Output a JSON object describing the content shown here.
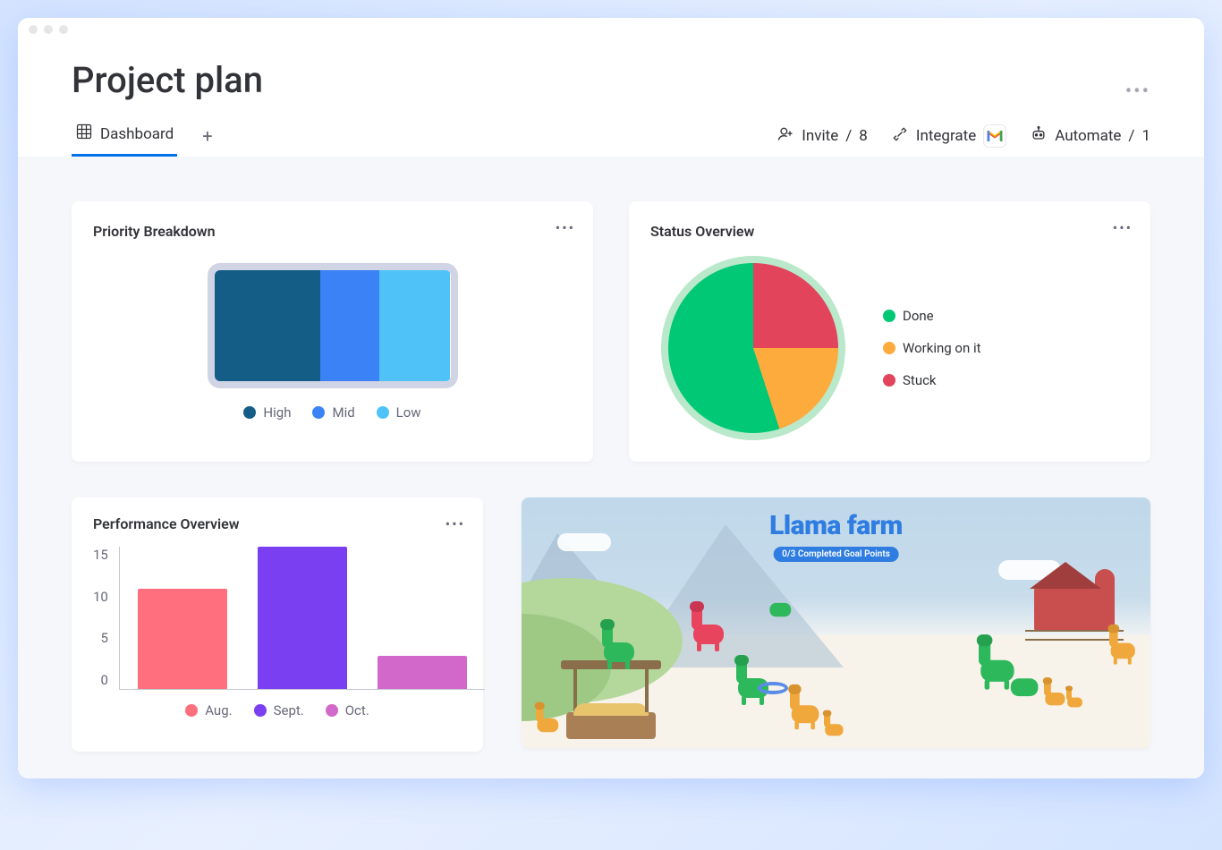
{
  "page": {
    "title": "Project plan"
  },
  "tabs": {
    "dashboard": "Dashboard"
  },
  "actions": {
    "invite_label": "Invite",
    "invite_count": "8",
    "integrate_label": "Integrate",
    "automate_label": "Automate",
    "automate_count": "1"
  },
  "cards": {
    "priority": {
      "title": "Priority Breakdown",
      "legend_high": "High",
      "legend_mid": "Mid",
      "legend_low": "Low"
    },
    "status": {
      "title": "Status Overview",
      "legend_done": "Done",
      "legend_working": "Working on it",
      "legend_stuck": "Stuck"
    },
    "performance": {
      "title": "Performance Overview",
      "y_15": "15",
      "y_10": "10",
      "y_5": "5",
      "y_0": "0",
      "legend_aug": "Aug.",
      "legend_sept": "Sept.",
      "legend_oct": "Oct."
    },
    "farm": {
      "title": "Llama farm",
      "badge": "0/3 Completed Goal Points"
    }
  },
  "colors": {
    "high": "#135d87",
    "mid": "#3b82f6",
    "low": "#4fc3f7",
    "done": "#00c875",
    "working": "#fdab3d",
    "stuck": "#e2445c",
    "aug": "#ff6f7d",
    "sept": "#7b3ff2",
    "oct": "#d268c9"
  },
  "chart_data": [
    {
      "type": "bar",
      "widget": "priority_battery",
      "categories": [
        "High",
        "Mid",
        "Low"
      ],
      "values": [
        45,
        25,
        30
      ],
      "unit": "percent_width",
      "title": "Priority Breakdown"
    },
    {
      "type": "pie",
      "widget": "status_overview",
      "series": [
        {
          "name": "Done",
          "value": 55,
          "color": "#00c875"
        },
        {
          "name": "Working on it",
          "value": 20,
          "color": "#fdab3d"
        },
        {
          "name": "Stuck",
          "value": 25,
          "color": "#e2445c"
        }
      ],
      "title": "Status Overview"
    },
    {
      "type": "bar",
      "widget": "performance_overview",
      "categories": [
        "Aug.",
        "Sept.",
        "Oct."
      ],
      "values": [
        12,
        17,
        4
      ],
      "title": "Performance Overview",
      "ylabel": "",
      "ylim": [
        0,
        17
      ],
      "yticks": [
        0,
        5,
        10,
        15
      ]
    }
  ]
}
